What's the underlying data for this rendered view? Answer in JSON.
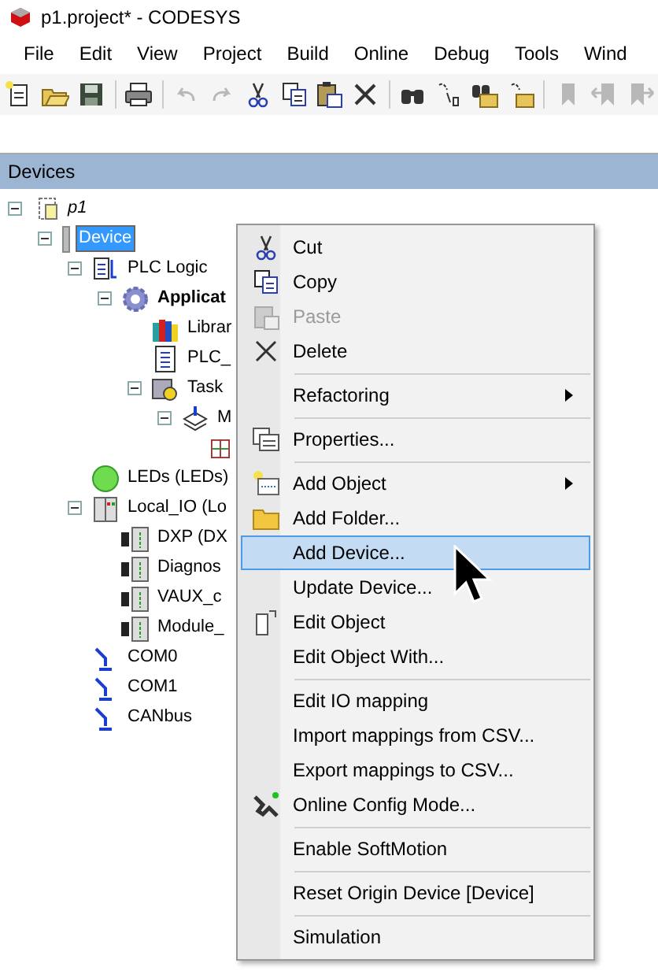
{
  "window": {
    "title": "p1.project* - CODESYS"
  },
  "menubar": [
    "File",
    "Edit",
    "View",
    "Project",
    "Build",
    "Online",
    "Debug",
    "Tools",
    "Wind"
  ],
  "toolbar": [
    {
      "kind": "new",
      "disabled": false
    },
    {
      "kind": "open",
      "disabled": false
    },
    {
      "kind": "save",
      "disabled": false
    },
    {
      "kind": "separator"
    },
    {
      "kind": "print",
      "disabled": false
    },
    {
      "kind": "separator"
    },
    {
      "kind": "undo",
      "disabled": true
    },
    {
      "kind": "redo",
      "disabled": true
    },
    {
      "kind": "cut",
      "disabled": false
    },
    {
      "kind": "copy",
      "disabled": false
    },
    {
      "kind": "paste",
      "disabled": false
    },
    {
      "kind": "delete",
      "disabled": false
    },
    {
      "kind": "separator"
    },
    {
      "kind": "find",
      "disabled": false
    },
    {
      "kind": "replace",
      "disabled": false
    },
    {
      "kind": "find-in-folder",
      "disabled": false
    },
    {
      "kind": "replace-in-folder",
      "disabled": false
    },
    {
      "kind": "separator"
    },
    {
      "kind": "bookmark",
      "disabled": true
    },
    {
      "kind": "bookmark-prev",
      "disabled": true
    },
    {
      "kind": "bookmark-next",
      "disabled": true
    }
  ],
  "panel": {
    "title": "Devices"
  },
  "tree": [
    {
      "label": "p1",
      "kind": "project",
      "expanded": true,
      "selected": false,
      "children": [
        {
          "label": "Device",
          "kind": "device",
          "expanded": true,
          "selected": true,
          "children": [
            {
              "label": "PLC Logic",
              "kind": "plc-logic",
              "expanded": true,
              "selected": false,
              "children": [
                {
                  "label": "Applicat",
                  "kind": "application",
                  "expanded": true,
                  "selected": false,
                  "children": [
                    {
                      "label": "Librar",
                      "kind": "library",
                      "selected": false
                    },
                    {
                      "label": "PLC_",
                      "kind": "pou",
                      "selected": false
                    },
                    {
                      "label": "Task",
                      "kind": "task-config",
                      "expanded": true,
                      "selected": false,
                      "children": [
                        {
                          "label": "M",
                          "kind": "task",
                          "expanded": true,
                          "selected": false,
                          "children": [
                            {
                              "kind": "call"
                            }
                          ]
                        }
                      ]
                    }
                  ]
                }
              ]
            },
            {
              "label": "LEDs (LEDs)",
              "kind": "led",
              "selected": false
            },
            {
              "label": "Local_IO (Lo",
              "kind": "io",
              "expanded": true,
              "selected": false,
              "children": [
                {
                  "label": "DXP (DX",
                  "kind": "module",
                  "selected": false
                },
                {
                  "label": "Diagnos",
                  "kind": "module",
                  "selected": false
                },
                {
                  "label": "VAUX_c",
                  "kind": "module",
                  "selected": false
                },
                {
                  "label": "Module_",
                  "kind": "module",
                  "selected": false
                }
              ]
            },
            {
              "label": "COM0",
              "kind": "port",
              "selected": false
            },
            {
              "label": "COM1",
              "kind": "port",
              "selected": false
            },
            {
              "label": "CANbus",
              "kind": "port",
              "selected": false
            }
          ]
        }
      ]
    }
  ],
  "context_menu": [
    {
      "kind": "item",
      "label": "Cut",
      "disabled": false,
      "selected": false,
      "submenu": false
    },
    {
      "kind": "item",
      "label": "Copy",
      "disabled": false,
      "selected": false,
      "submenu": false
    },
    {
      "kind": "item",
      "label": "Paste",
      "disabled": true,
      "selected": false,
      "submenu": false
    },
    {
      "kind": "item",
      "label": "Delete",
      "disabled": false,
      "selected": false,
      "submenu": false
    },
    {
      "kind": "separator"
    },
    {
      "kind": "item",
      "label": "Refactoring",
      "disabled": false,
      "selected": false,
      "submenu": true
    },
    {
      "kind": "separator"
    },
    {
      "kind": "item",
      "label": "Properties...",
      "disabled": false,
      "selected": false,
      "submenu": false
    },
    {
      "kind": "separator"
    },
    {
      "kind": "item",
      "label": "Add Object",
      "disabled": false,
      "selected": false,
      "submenu": true
    },
    {
      "kind": "item",
      "label": "Add Folder...",
      "disabled": false,
      "selected": false,
      "submenu": false
    },
    {
      "kind": "item",
      "label": "Add Device...",
      "disabled": false,
      "selected": true,
      "submenu": false
    },
    {
      "kind": "item",
      "label": "Update Device...",
      "disabled": false,
      "selected": false,
      "submenu": false
    },
    {
      "kind": "item",
      "label": "Edit Object",
      "disabled": false,
      "selected": false,
      "submenu": false
    },
    {
      "kind": "item",
      "label": "Edit Object With...",
      "disabled": false,
      "selected": false,
      "submenu": false
    },
    {
      "kind": "separator"
    },
    {
      "kind": "item",
      "label": "Edit IO mapping",
      "disabled": false,
      "selected": false,
      "submenu": false
    },
    {
      "kind": "item",
      "label": "Import mappings from CSV...",
      "disabled": false,
      "selected": false,
      "submenu": false
    },
    {
      "kind": "item",
      "label": "Export mappings to CSV...",
      "disabled": false,
      "selected": false,
      "submenu": false
    },
    {
      "kind": "item",
      "label": "Online Config Mode...",
      "disabled": false,
      "selected": false,
      "submenu": false
    },
    {
      "kind": "separator"
    },
    {
      "kind": "item",
      "label": "Enable SoftMotion",
      "disabled": false,
      "selected": false,
      "submenu": false
    },
    {
      "kind": "separator"
    },
    {
      "kind": "item",
      "label": "Reset Origin Device [Device]",
      "disabled": false,
      "selected": false,
      "submenu": false
    },
    {
      "kind": "separator"
    },
    {
      "kind": "item",
      "label": "Simulation",
      "disabled": false,
      "selected": false,
      "submenu": false
    }
  ]
}
